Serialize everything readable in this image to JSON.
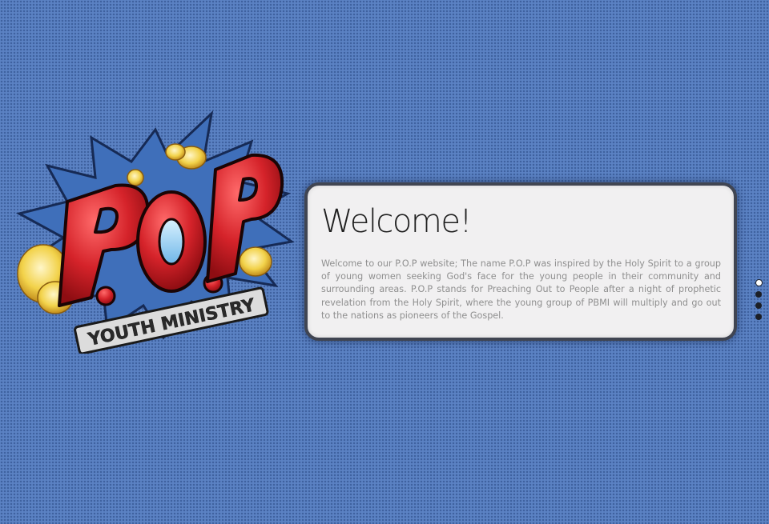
{
  "logo": {
    "wordmark": "P.O.P",
    "tagline": "YOUTH MINISTRY"
  },
  "welcome": {
    "title": "Welcome!",
    "body": "Welcome to our P.O.P website; The name P.O.P was inspired by the Holy Spirit to a group of young women seeking God's face for the young people in their community and surrounding areas. P.O.P stands for Preaching Out to People after a night of prophetic revelation from the Holy Spirit, where the young group of PBMI will multiply and go out to the nations as pioneers of the Gospel."
  },
  "pagination": {
    "total": 4,
    "active_index": 0
  },
  "colors": {
    "background": "#5b82c3",
    "card": "#f1f0f1",
    "card_border": "#404552",
    "logo_red": "#d5232a",
    "logo_yellow": "#f2d24a",
    "starburst": "#3f6fba"
  }
}
